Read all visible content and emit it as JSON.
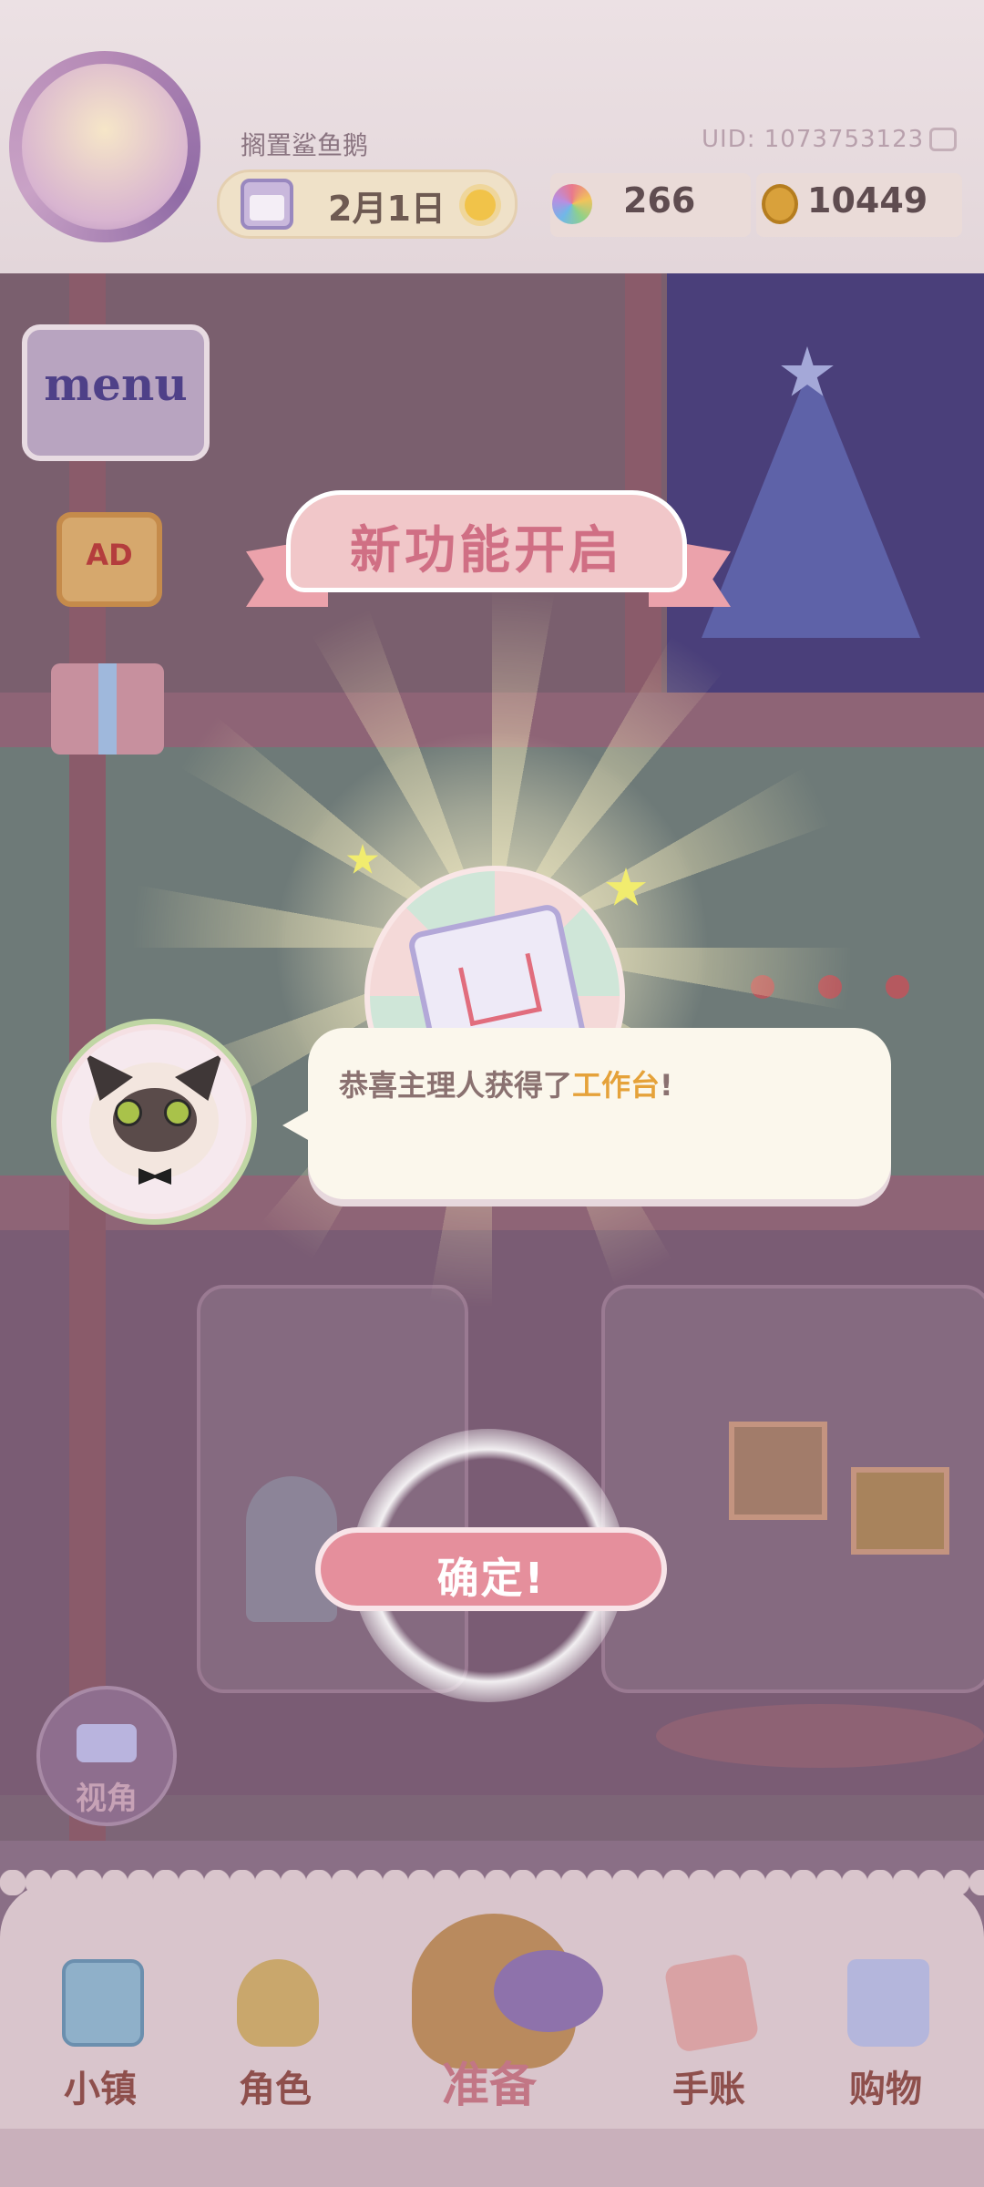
{
  "header": {
    "player_name": "搁置鲨鱼鹅",
    "uid": "UID: 1073753123",
    "date": "2月1日",
    "gems": "266",
    "coins": "10449"
  },
  "side_buttons": {
    "menu_label": "menu",
    "ad_label": "AD",
    "view_label": "视角"
  },
  "popup": {
    "banner_title": "新功能开启",
    "message_prefix": "恭喜主理人获得了",
    "message_highlight": "工作台",
    "message_suffix": "!",
    "confirm_label": "确定!",
    "highlight_color": "#e5a23a",
    "accent_color": "#e58f9c"
  },
  "bottom_nav": {
    "items": [
      {
        "label": "小镇",
        "icon": "map-icon"
      },
      {
        "label": "角色",
        "icon": "character-icon"
      },
      {
        "label": "准备",
        "icon": "basket-icon"
      },
      {
        "label": "手账",
        "icon": "journal-icon"
      },
      {
        "label": "购物",
        "icon": "shopping-bag-icon"
      }
    ]
  }
}
